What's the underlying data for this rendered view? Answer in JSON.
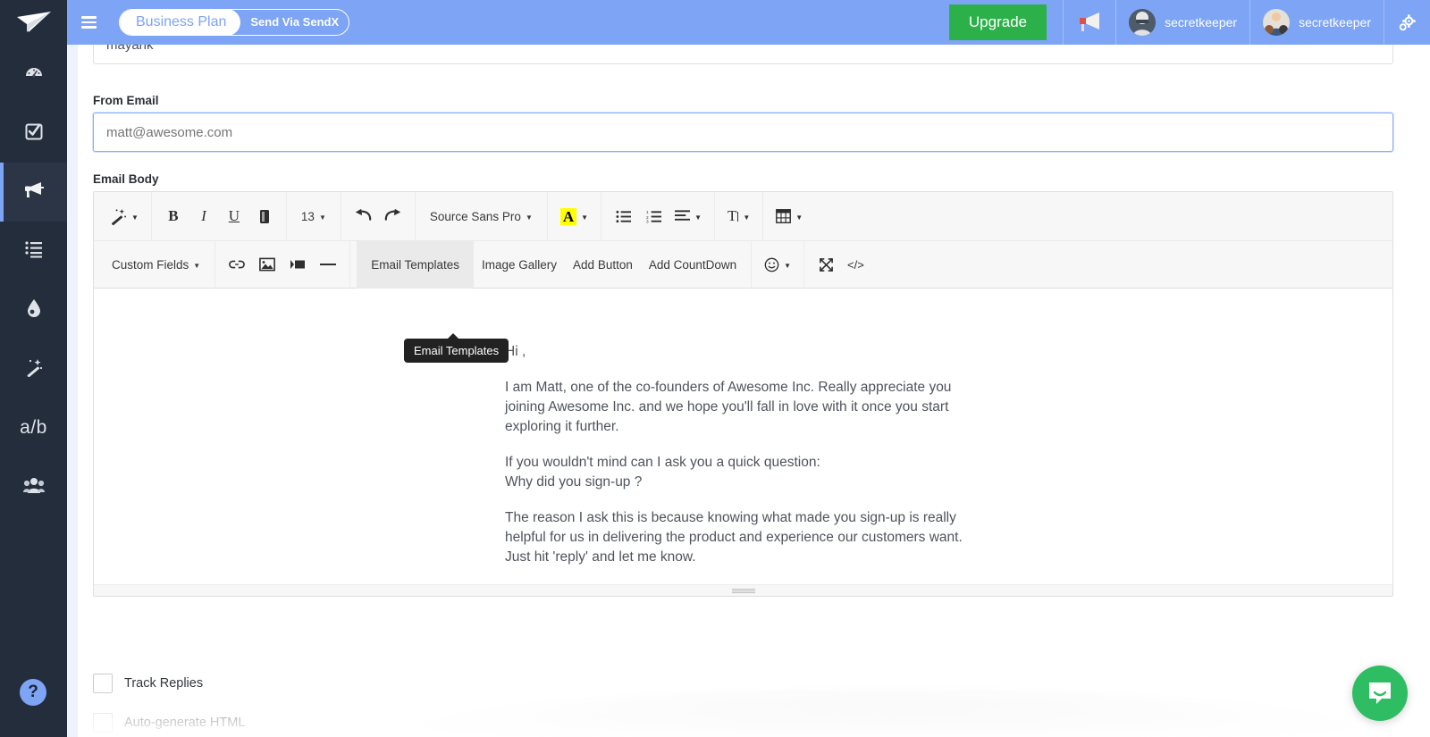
{
  "app": {
    "logo_icon": "paper-plane-icon"
  },
  "header": {
    "menu_icon": "hamburger-icon",
    "plan_name": "Business Plan",
    "plan_action": "Send Via SendX",
    "upgrade_label": "Upgrade",
    "megaphone_icon": "megaphone-icon",
    "account_name": "secretkeeper",
    "team_name": "secretkeeper",
    "settings_icon": "gear-icon",
    "bg_color": "#7da4f5",
    "upgrade_color": "#2cb14a"
  },
  "sidebar": {
    "bg_color": "#242d3c",
    "active_bar_color": "#7da4f5",
    "items": [
      {
        "name": "dashboard",
        "icon": "speedometer-icon",
        "glyph": "⚡",
        "active": false
      },
      {
        "name": "tasks",
        "icon": "checkbox-check-icon",
        "glyph": "☑",
        "active": false
      },
      {
        "name": "campaigns",
        "icon": "megaphone-icon",
        "glyph": "📣",
        "active": true
      },
      {
        "name": "lists",
        "icon": "list-icon",
        "glyph": "☰",
        "active": false
      },
      {
        "name": "drip",
        "icon": "droplet-icon",
        "glyph": "💧",
        "active": false
      },
      {
        "name": "automation",
        "icon": "magic-wand-icon",
        "glyph": "✨",
        "active": false
      },
      {
        "name": "ab-testing",
        "icon": "ab-test-label",
        "glyph": "a/b",
        "active": false
      },
      {
        "name": "contacts",
        "icon": "people-icon",
        "glyph": "👥",
        "active": false
      }
    ],
    "help_icon": "question-mark-icon",
    "help_label": "?"
  },
  "form": {
    "name_value": "mayank",
    "from_email_label": "From Email",
    "from_email_value": "",
    "from_email_placeholder": "matt@awesome.com",
    "email_body_label": "Email Body"
  },
  "editor": {
    "toolbar_row1": [
      {
        "name": "more-styles-button",
        "label": "",
        "icon": "magic-wand-icon",
        "glyph": "✨",
        "caret": true
      },
      {
        "name": "bold-button",
        "label": "B",
        "icon": "bold-icon",
        "caret": false
      },
      {
        "name": "italic-button",
        "label": "I",
        "icon": "italic-icon",
        "caret": false
      },
      {
        "name": "underline-button",
        "label": "U",
        "icon": "underline-icon",
        "caret": false
      },
      {
        "name": "clear-formatting-button",
        "label": "",
        "icon": "eraser-icon",
        "glyph": "▤",
        "caret": false
      },
      {
        "name": "font-size-select",
        "label": "13",
        "icon": "font-size-icon",
        "caret": true
      },
      {
        "name": "undo-button",
        "label": "",
        "icon": "undo-icon",
        "glyph": "↶",
        "caret": false
      },
      {
        "name": "redo-button",
        "label": "",
        "icon": "redo-icon",
        "glyph": "↷",
        "caret": false
      },
      {
        "name": "font-family-select",
        "label": "Source Sans Pro",
        "icon": "font-family-icon",
        "caret": true
      },
      {
        "name": "text-highlight-button",
        "label": "A",
        "icon": "highlight-color-icon",
        "caret": true
      },
      {
        "name": "unordered-list-button",
        "label": "",
        "icon": "bullet-list-icon",
        "glyph": "☰",
        "caret": false
      },
      {
        "name": "ordered-list-button",
        "label": "",
        "icon": "numbered-list-icon",
        "glyph": "☰",
        "caret": false
      },
      {
        "name": "align-button",
        "label": "",
        "icon": "align-left-icon",
        "glyph": "☰",
        "caret": true
      },
      {
        "name": "line-height-button",
        "label": "T",
        "icon": "line-height-icon",
        "caret": true
      },
      {
        "name": "insert-table-button",
        "label": "",
        "icon": "table-icon",
        "glyph": "⊞",
        "caret": true
      }
    ],
    "toolbar_row2": [
      {
        "name": "custom-fields-menu",
        "label": "Custom Fields",
        "icon": "custom-fields-icon",
        "caret": true,
        "type": "text"
      },
      {
        "name": "insert-link-button",
        "label": "",
        "icon": "link-icon",
        "glyph": "🔗",
        "caret": false,
        "type": "icon"
      },
      {
        "name": "insert-image-button",
        "label": "",
        "icon": "image-icon",
        "glyph": "🖼",
        "caret": false,
        "type": "icon"
      },
      {
        "name": "insert-video-button",
        "label": "",
        "icon": "video-icon",
        "glyph": "▶",
        "caret": false,
        "type": "icon"
      },
      {
        "name": "horizontal-rule-button",
        "label": "",
        "icon": "horizontal-line-icon",
        "glyph": "—",
        "caret": false,
        "type": "icon"
      },
      {
        "name": "email-templates-button",
        "label": "Email Templates",
        "icon": "templates-icon",
        "caret": false,
        "type": "text",
        "hovered": true
      },
      {
        "name": "image-gallery-button",
        "label": "Image Gallery",
        "icon": "gallery-icon",
        "caret": false,
        "type": "text"
      },
      {
        "name": "add-button-button",
        "label": "Add Button",
        "icon": "add-button-icon",
        "caret": false,
        "type": "text"
      },
      {
        "name": "add-countdown-button",
        "label": "Add CountDown",
        "icon": "countdown-icon",
        "caret": false,
        "type": "text"
      },
      {
        "name": "emoji-button",
        "label": "",
        "icon": "smiley-icon",
        "glyph": "☺",
        "caret": true,
        "type": "icon"
      },
      {
        "name": "fullscreen-button",
        "label": "",
        "icon": "expand-arrows-icon",
        "glyph": "⤡",
        "caret": false,
        "type": "icon"
      },
      {
        "name": "code-view-button",
        "label": "",
        "icon": "code-brackets-icon",
        "glyph": "</>",
        "caret": false,
        "type": "icon"
      }
    ],
    "tooltip_text": "Email Templates",
    "body_paragraphs": [
      "Hi ,",
      "I am Matt, one of the co-founders of Awesome Inc. Really appreciate you joining Awesome Inc. and we hope you'll fall in love with it once you start exploring it further.",
      "If you wouldn't mind can I ask you a quick question:\nWhy did you sign-up ?",
      "The reason I ask this is because knowing what made you sign-up is really helpful for us in delivering the product and experience our customers want. Just hit 'reply' and let me know."
    ],
    "resize_handle": "resize-grip"
  },
  "options": {
    "track_replies_label": "Track Replies",
    "track_replies_checked": false,
    "auto_generate_label": "Auto-generate HTML",
    "auto_generate_checked": false
  },
  "widget": {
    "name": "intercom-launcher",
    "icon": "chat-bubble-icon",
    "color": "#2fbd63"
  }
}
